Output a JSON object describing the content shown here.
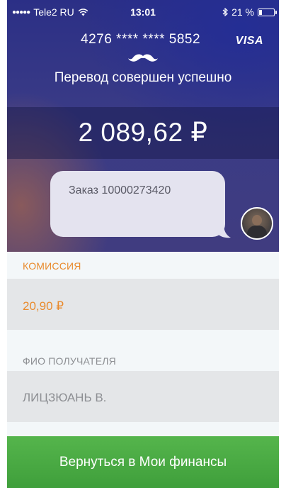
{
  "status_bar": {
    "signal_dots": "●●●●●",
    "carrier": "Tele2 RU",
    "wifi_icon": "wifi-icon",
    "time": "13:01",
    "bluetooth_icon": "bluetooth-icon",
    "battery_percent": "21 %",
    "battery_level": 0.21
  },
  "card": {
    "number": "4276 **** **** 5852",
    "brand": "VISA"
  },
  "transfer": {
    "status": "Перевод совершен успешно",
    "amount": "2 089,62 ₽",
    "message": "Заказ 10000273420"
  },
  "details": {
    "commission_label": "КОМИССИЯ",
    "commission_value": "20,90 ₽",
    "recipient_label": "ФИО ПОЛУЧАТЕЛЯ",
    "recipient_value": "ЛИЦЗЮАНЬ В."
  },
  "actions": {
    "back_label": "Вернуться в Мои финансы"
  },
  "colors": {
    "accent_orange": "#e98b2e",
    "button_green": "#4caf45",
    "hero_blue": "#2b2f86"
  }
}
